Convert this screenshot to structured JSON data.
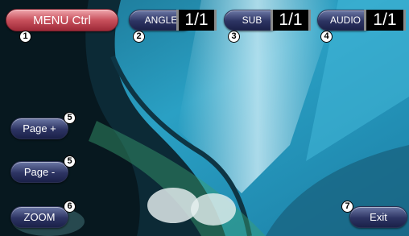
{
  "buttons": {
    "menu_ctrl": "MENU Ctrl",
    "angle": "ANGLE",
    "sub": "SUB",
    "audio": "AUDIO",
    "page_plus": "Page +",
    "page_minus": "Page -",
    "zoom": "ZOOM",
    "exit": "Exit"
  },
  "counters": {
    "angle": "1/1",
    "sub": "1/1",
    "audio": "1/1"
  },
  "callouts": {
    "menu_ctrl": "1",
    "angle": "2",
    "sub": "3",
    "audio": "4",
    "page_plus": "5",
    "page_minus": "5",
    "zoom": "6",
    "exit": "7"
  },
  "colors": {
    "menu_button": "#c8505c",
    "control_button": "#2d3463",
    "counter_bg": "#000000"
  }
}
